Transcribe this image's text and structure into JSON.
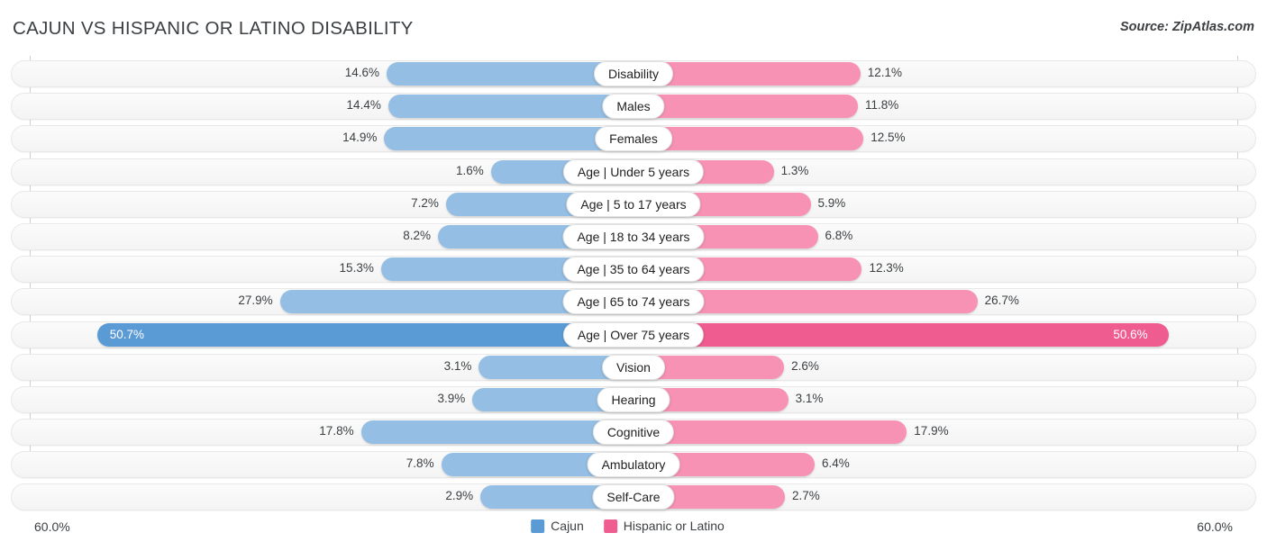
{
  "header": {
    "title": "CAJUN VS HISPANIC OR LATINO DISABILITY",
    "source": "Source: ZipAtlas.com"
  },
  "footer": {
    "axis_left": "60.0%",
    "axis_right": "60.0%",
    "legend": [
      {
        "label": "Cajun",
        "color": "#5B9BD5"
      },
      {
        "label": "Hispanic or Latino",
        "color": "#EF5C90"
      }
    ]
  },
  "colors": {
    "cajun_light": "#94BEE4",
    "cajun_strong": "#5B9BD5",
    "latino_light": "#F792B4",
    "latino_strong": "#EF5C90",
    "track": "#f6f6f6",
    "text": "#3c4043"
  },
  "chart_data": {
    "type": "bar",
    "title": "CAJUN VS HISPANIC OR LATINO DISABILITY",
    "subtitle": "Source: ZipAtlas.com",
    "orientation": "horizontal-diverging",
    "xlabel": "",
    "ylabel": "",
    "xlim": [
      0,
      60
    ],
    "axis_max_label": "60.0%",
    "grid": false,
    "legend_position": "bottom-center",
    "categories": [
      "Disability",
      "Males",
      "Females",
      "Age | Under 5 years",
      "Age | 5 to 17 years",
      "Age | 18 to 34 years",
      "Age | 35 to 64 years",
      "Age | 65 to 74 years",
      "Age | Over 75 years",
      "Vision",
      "Hearing",
      "Cognitive",
      "Ambulatory",
      "Self-Care"
    ],
    "series": [
      {
        "name": "Cajun",
        "side": "left",
        "color": "#94BEE4",
        "values": [
          14.6,
          14.4,
          14.9,
          1.6,
          7.2,
          8.2,
          15.3,
          27.9,
          50.7,
          3.1,
          3.9,
          17.8,
          7.8,
          2.9
        ],
        "labels": [
          "14.6%",
          "14.4%",
          "14.9%",
          "1.6%",
          "7.2%",
          "8.2%",
          "15.3%",
          "27.9%",
          "50.7%",
          "3.1%",
          "3.9%",
          "17.8%",
          "7.8%",
          "2.9%"
        ]
      },
      {
        "name": "Hispanic or Latino",
        "side": "right",
        "color": "#F792B4",
        "values": [
          12.1,
          11.8,
          12.5,
          1.3,
          5.9,
          6.8,
          12.3,
          26.7,
          50.6,
          2.6,
          3.1,
          17.9,
          6.4,
          2.7
        ],
        "labels": [
          "12.1%",
          "11.8%",
          "12.5%",
          "1.3%",
          "5.9%",
          "6.8%",
          "12.3%",
          "26.7%",
          "50.6%",
          "2.6%",
          "3.1%",
          "17.9%",
          "6.4%",
          "2.7%"
        ]
      }
    ],
    "highlighted_row": "Age | Over 75 years"
  }
}
